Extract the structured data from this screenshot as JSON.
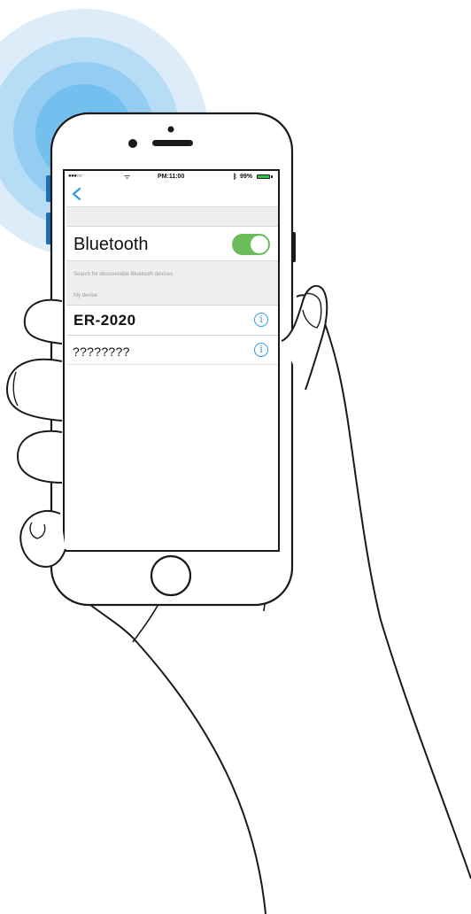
{
  "status_bar": {
    "signal": "●●●○○",
    "time": "PM:11:00",
    "bluetooth_icon": "bluetooth-icon",
    "battery": "99%",
    "battery_level": 0.99
  },
  "nav": {
    "back_icon": "chevron-left-icon"
  },
  "bluetooth": {
    "label": "Bluetooth",
    "enabled": true,
    "search_hint": "Search for discoverable Bluetooth devices",
    "section_header": "My device"
  },
  "devices": [
    {
      "name": "ER-2020",
      "icon": "info-icon",
      "icon_glyph": "i"
    },
    {
      "name": "????????",
      "icon": "info-icon",
      "icon_glyph": "i"
    }
  ],
  "colors": {
    "toggle_on": "#6cbd5a",
    "accent": "#2e9be6",
    "ripple": "#6cc4ef"
  }
}
